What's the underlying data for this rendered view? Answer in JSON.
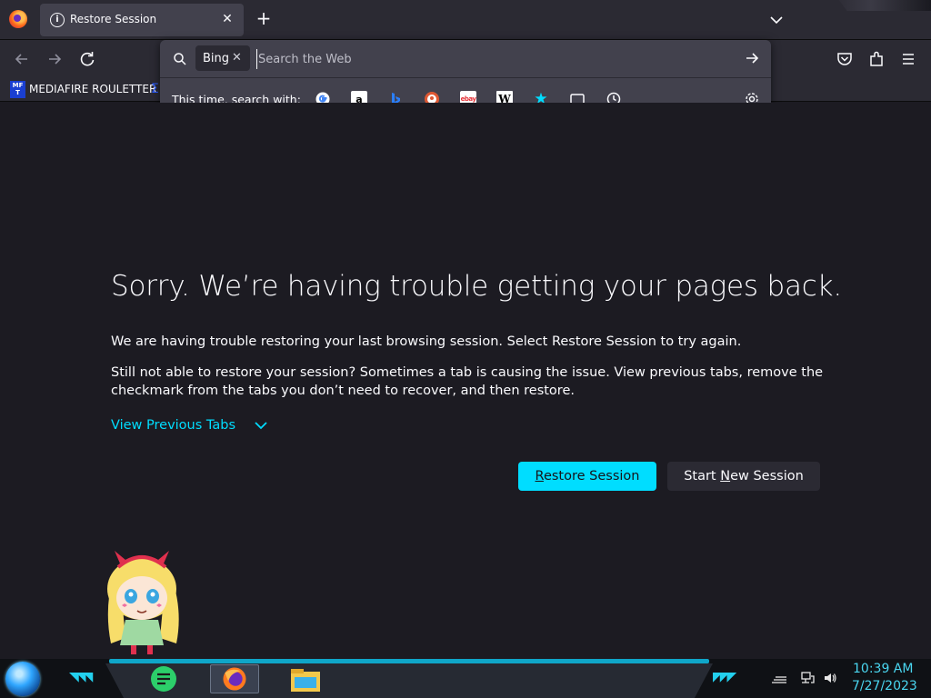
{
  "browser": {
    "tab": {
      "title": "Restore Session"
    },
    "bookmarks": {
      "item_label": "MEDIAFIRE ROULETTER",
      "item_icon_text": "MF T"
    }
  },
  "urlbar": {
    "engine": "Bing",
    "placeholder": "Search the Web",
    "oneoff_label": "This time, search with:",
    "oneoffs": [
      "google-icon",
      "amazon-icon",
      "bing-icon",
      "duckduckgo-icon",
      "ebay-icon",
      "wikipedia-icon",
      "bookmarks-icon",
      "tabs-icon",
      "history-icon"
    ]
  },
  "page": {
    "heading": "Sorry. We’re having trouble getting your pages back.",
    "para1": "We are having trouble restoring your last browsing session. Select Restore Session to try again.",
    "para2": "Still not able to restore your session? Sometimes a tab is causing the issue. View previous tabs, remove the checkmark from the tabs you don’t need to recover, and then restore.",
    "view_previous": "View Previous Tabs",
    "restore_button": {
      "underlined": "R",
      "rest": "estore Session"
    },
    "new_session_button": {
      "before": "Start ",
      "underlined": "N",
      "rest": "ew Session"
    }
  },
  "taskbar": {
    "time": "10:39 AM",
    "date": "7/27/2023"
  },
  "colors": {
    "accent": "#00ddff",
    "background": "#1c1b22",
    "toolbar": "#2b2a33",
    "clock": "#4ad6f0"
  }
}
